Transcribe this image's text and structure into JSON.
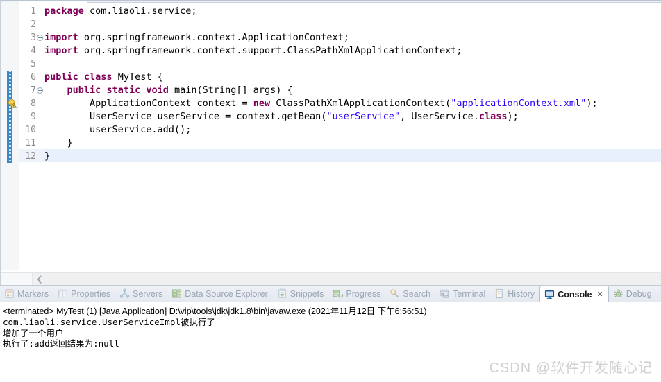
{
  "editor": {
    "gutter": {
      "line_numbers": [
        "1",
        "2",
        "3",
        "4",
        "5",
        "6",
        "7",
        "8",
        "9",
        "10",
        "11",
        "12"
      ],
      "fold_lines": [
        3,
        7
      ],
      "warning_line": 8,
      "warning_icon": "warning-bulb-icon",
      "change_bar_from": 6,
      "change_bar_to": 12,
      "current_line": 12
    },
    "scrollbar": {
      "left_arrow_icon": "chevron-left-icon"
    },
    "lines": [
      {
        "n": "1",
        "tokens": [
          {
            "t": "kw",
            "v": "package"
          },
          {
            "t": "plain",
            "v": " com.liaoli.service;"
          }
        ]
      },
      {
        "n": "2",
        "tokens": []
      },
      {
        "n": "3",
        "tokens": [
          {
            "t": "kw",
            "v": "import"
          },
          {
            "t": "plain",
            "v": " org.springframework.context.ApplicationContext;"
          }
        ]
      },
      {
        "n": "4",
        "tokens": [
          {
            "t": "kw",
            "v": "import"
          },
          {
            "t": "plain",
            "v": " org.springframework.context.support.ClassPathXmlApplicationContext;"
          }
        ]
      },
      {
        "n": "5",
        "tokens": []
      },
      {
        "n": "6",
        "tokens": [
          {
            "t": "kw",
            "v": "public"
          },
          {
            "t": "plain",
            "v": " "
          },
          {
            "t": "kw",
            "v": "class"
          },
          {
            "t": "plain",
            "v": " MyTest {"
          }
        ]
      },
      {
        "n": "7",
        "tokens": [
          {
            "t": "plain",
            "v": "    "
          },
          {
            "t": "kw",
            "v": "public"
          },
          {
            "t": "plain",
            "v": " "
          },
          {
            "t": "kw",
            "v": "static"
          },
          {
            "t": "plain",
            "v": " "
          },
          {
            "t": "kw",
            "v": "void"
          },
          {
            "t": "plain",
            "v": " main(String[] args) {"
          }
        ]
      },
      {
        "n": "8",
        "tokens": [
          {
            "t": "plain",
            "v": "        ApplicationContext "
          },
          {
            "t": "warnvar",
            "v": "context"
          },
          {
            "t": "plain",
            "v": " = "
          },
          {
            "t": "kw",
            "v": "new"
          },
          {
            "t": "plain",
            "v": " ClassPathXmlApplicationContext("
          },
          {
            "t": "str",
            "v": "\"applicationContext.xml\""
          },
          {
            "t": "plain",
            "v": ");"
          }
        ]
      },
      {
        "n": "9",
        "tokens": [
          {
            "t": "plain",
            "v": "        UserService userService = context.getBean("
          },
          {
            "t": "str",
            "v": "\"userService\""
          },
          {
            "t": "plain",
            "v": ", UserService."
          },
          {
            "t": "kw",
            "v": "class"
          },
          {
            "t": "plain",
            "v": ");"
          }
        ]
      },
      {
        "n": "10",
        "tokens": [
          {
            "t": "plain",
            "v": "        userService.add();"
          }
        ]
      },
      {
        "n": "11",
        "tokens": [
          {
            "t": "plain",
            "v": "    }"
          }
        ]
      },
      {
        "n": "12",
        "tokens": [
          {
            "t": "plain",
            "v": "}"
          }
        ]
      }
    ]
  },
  "view_tabs": [
    {
      "label": "Markers",
      "icon": "markers-icon",
      "active": false
    },
    {
      "label": "Properties",
      "icon": "properties-icon",
      "active": false
    },
    {
      "label": "Servers",
      "icon": "servers-icon",
      "active": false
    },
    {
      "label": "Data Source Explorer",
      "icon": "database-icon",
      "active": false
    },
    {
      "label": "Snippets",
      "icon": "snippets-icon",
      "active": false
    },
    {
      "label": "Progress",
      "icon": "progress-icon",
      "active": false
    },
    {
      "label": "Search",
      "icon": "search-icon",
      "active": false
    },
    {
      "label": "Terminal",
      "icon": "terminal-icon",
      "active": false
    },
    {
      "label": "History",
      "icon": "history-icon",
      "active": false
    },
    {
      "label": "Console",
      "icon": "console-icon",
      "active": true,
      "close_glyph": "✕"
    },
    {
      "label": "Debug",
      "icon": "debug-icon",
      "active": false
    }
  ],
  "console": {
    "header": "<terminated> MyTest (1) [Java Application] D:\\vip\\tools\\jdk\\jdk1.8\\bin\\javaw.exe (2021年11月12日 下午6:56:51)",
    "output": "com.liaoli.service.UserServiceImpl被执行了\n增加了一个用户\n执行了:add返回结果为:null"
  },
  "watermark": "CSDN @软件开发随心记",
  "colors": {
    "keyword": "#7f0055",
    "string": "#2a00ff",
    "current_line": "#e8f0fc",
    "change_bar": "#2e84c8",
    "tab_inactive_text": "#9aa6b4"
  }
}
